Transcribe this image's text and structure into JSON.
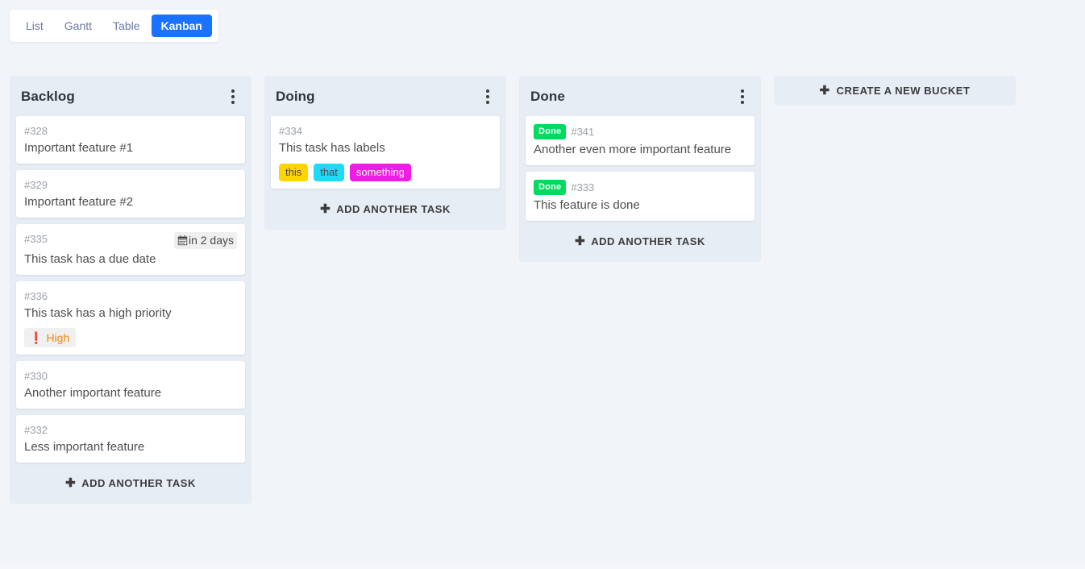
{
  "view_tabs": {
    "items": [
      {
        "label": "List",
        "active": false
      },
      {
        "label": "Gantt",
        "active": false
      },
      {
        "label": "Table",
        "active": false
      },
      {
        "label": "Kanban",
        "active": true
      }
    ],
    "active_color": "#1973ff",
    "inactive_color": "#6c79a5"
  },
  "board": {
    "create_bucket_label": "Create a new bucket",
    "add_task_label": "Add another task",
    "menu_icon": "dots-vertical-icon",
    "plus_icon": "plus-icon",
    "buckets": [
      {
        "title": "Backlog",
        "tasks": [
          {
            "id": "#328",
            "title": "Important feature #1"
          },
          {
            "id": "#329",
            "title": "Important feature #2"
          },
          {
            "id": "#335",
            "title": "This task has a due date",
            "due_date": {
              "text": "in 2 days",
              "icon": "calendar-icon"
            }
          },
          {
            "id": "#336",
            "title": "This task has a high priority",
            "priority": {
              "text": "High",
              "icon": "exclamation-icon",
              "color": "#f2890d"
            }
          },
          {
            "id": "#330",
            "title": "Another important feature"
          },
          {
            "id": "#332",
            "title": "Less important feature"
          }
        ]
      },
      {
        "title": "Doing",
        "tasks": [
          {
            "id": "#334",
            "title": "This task has labels",
            "labels": [
              {
                "text": "this",
                "bg": "#ffd500",
                "fg": "#4d4d4d"
              },
              {
                "text": "that",
                "bg": "#22d9f5",
                "fg": "#4d4d4d"
              },
              {
                "text": "something",
                "bg": "#ef1ce3",
                "fg": "#ffffff"
              }
            ]
          }
        ]
      },
      {
        "title": "Done",
        "tasks": [
          {
            "id": "#341",
            "title": "Another even more important feature",
            "done_badge": "Done"
          },
          {
            "id": "#333",
            "title": "This feature is done",
            "done_badge": "Done"
          }
        ]
      }
    ]
  }
}
